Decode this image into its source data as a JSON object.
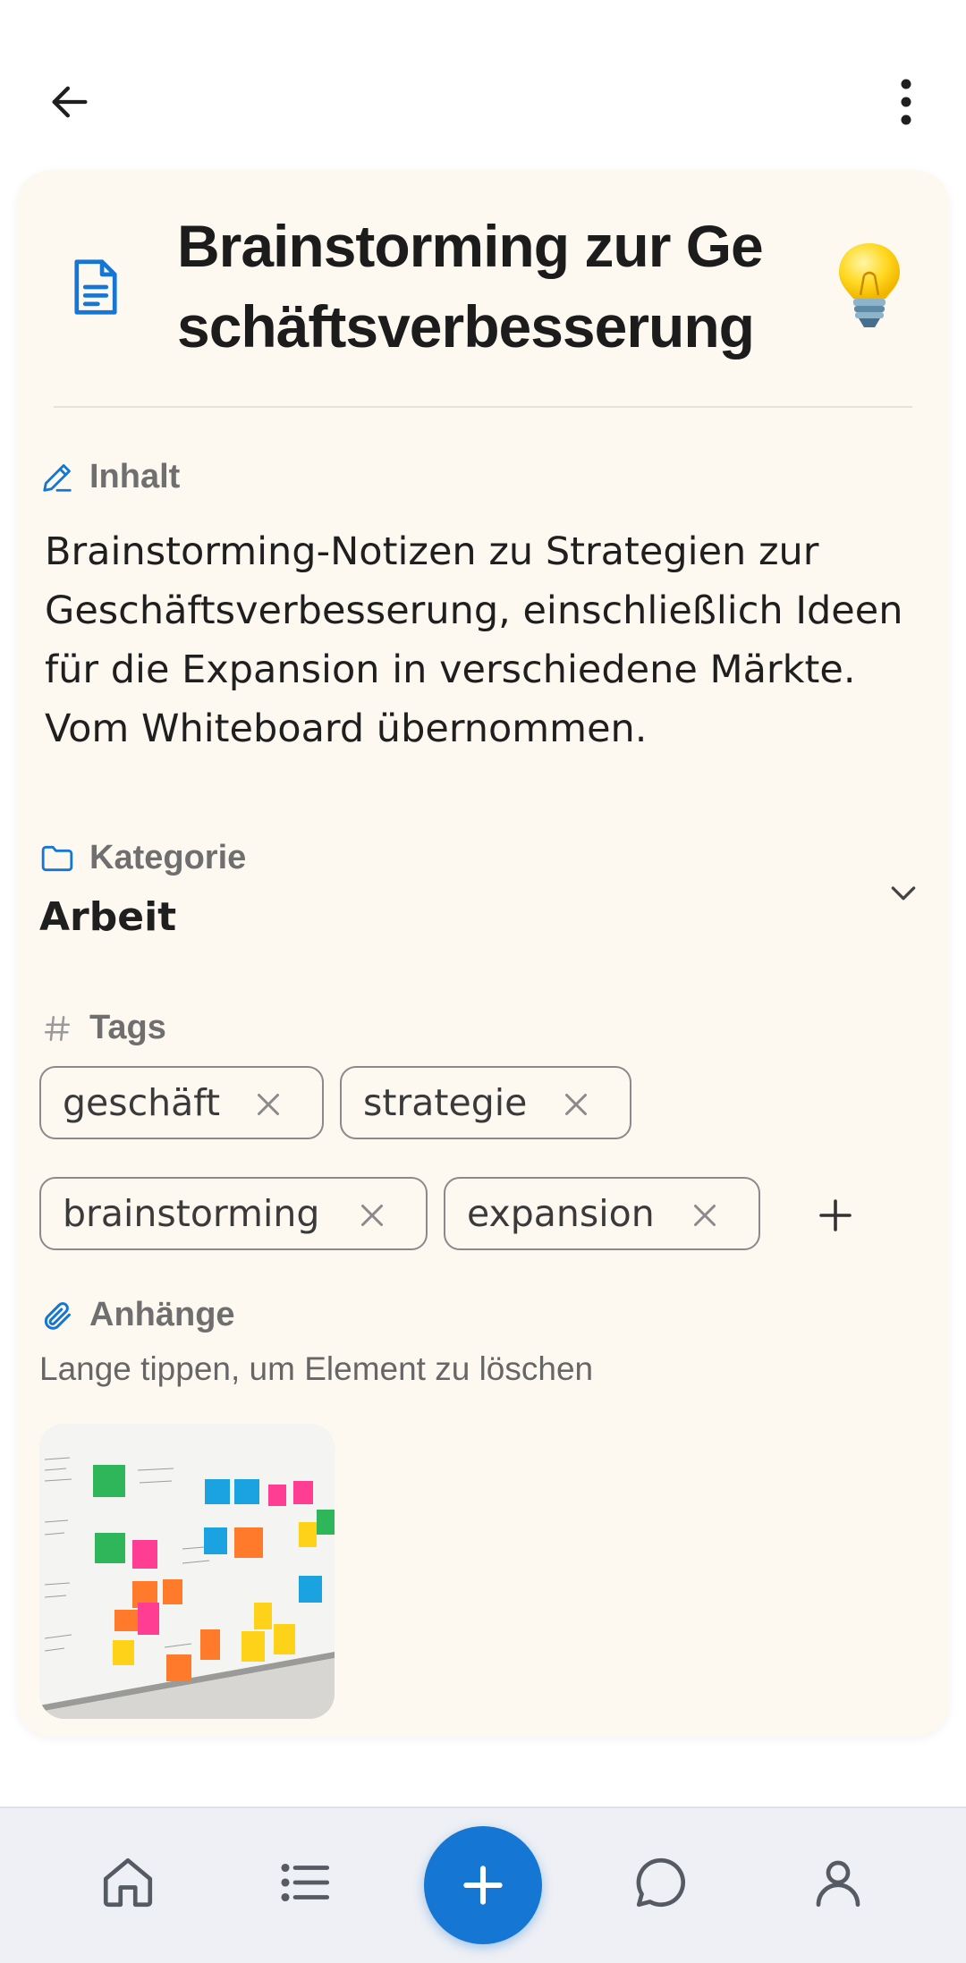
{
  "header": {
    "back_icon": "arrow-left-icon",
    "more_icon": "more-vertical-icon"
  },
  "note": {
    "title": "Brainstorming zur Ge schäftsverbesserung",
    "title_icon": "document-icon",
    "emoji": "light-bulb",
    "content": {
      "label": "Inhalt",
      "icon": "pencil-icon",
      "text": "Brainstorming-Notizen zu Strategien zur Geschäftsverbesserung, einschließlich Ideen für die Expansion in verschiedene Märkte. Vom Whiteboard übernommen."
    },
    "category": {
      "label": "Kategorie",
      "icon": "folder-icon",
      "value": "Arbeit"
    },
    "tags": {
      "label": "Tags",
      "icon": "hash-icon",
      "items": [
        "geschäft",
        "strategie",
        "brainstorming",
        "expansion"
      ]
    },
    "attachments": {
      "label": "Anhänge",
      "icon": "paperclip-icon",
      "hint": "Lange tippen, um Element zu löschen",
      "items": [
        "whiteboard-sticky-notes-photo"
      ]
    }
  },
  "bottom_nav": {
    "items": [
      "home-icon",
      "list-icon",
      "plus-icon",
      "chat-icon",
      "profile-icon"
    ]
  },
  "colors": {
    "accent": "#1576d4",
    "card_background": "#fdf9f1",
    "nav_background": "#eef0f5"
  }
}
